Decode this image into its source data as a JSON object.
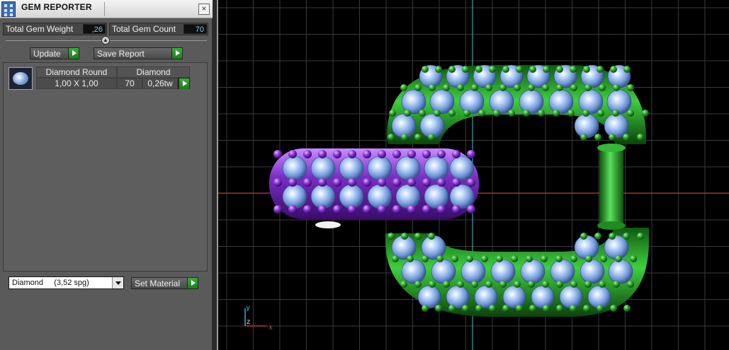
{
  "panel": {
    "title": "GEM REPORTER",
    "close_symbol": "×",
    "total_weight_label": "Total Gem Weight",
    "total_weight_value": ",26",
    "total_count_label": "Total Gem Count",
    "total_count_value": "70",
    "update_label": "Update",
    "save_report_label": "Save Report",
    "gem_rows": [
      {
        "shape": "Diamond Round",
        "material": "Diamond",
        "size": "1,00 X 1,00",
        "count": "70",
        "weight": "0,26tw"
      }
    ],
    "material_select": "Diamond     (3,52 spg)",
    "set_material_label": "Set Material"
  },
  "viewport": {
    "axis_labels": {
      "y": "y",
      "z": "z",
      "x": "x"
    }
  },
  "colors": {
    "panel_bg": "#5a5a5a",
    "value_text": "#6fd6ff",
    "accent_green": "#2fa02f",
    "metal_green": "#2cb02c",
    "metal_purple": "#7a2fc4",
    "gem_blue": "#8fb6ec",
    "grid": "#3a3a3a",
    "axis_red": "#c0392b",
    "axis_cyan": "#3fc0d0"
  }
}
